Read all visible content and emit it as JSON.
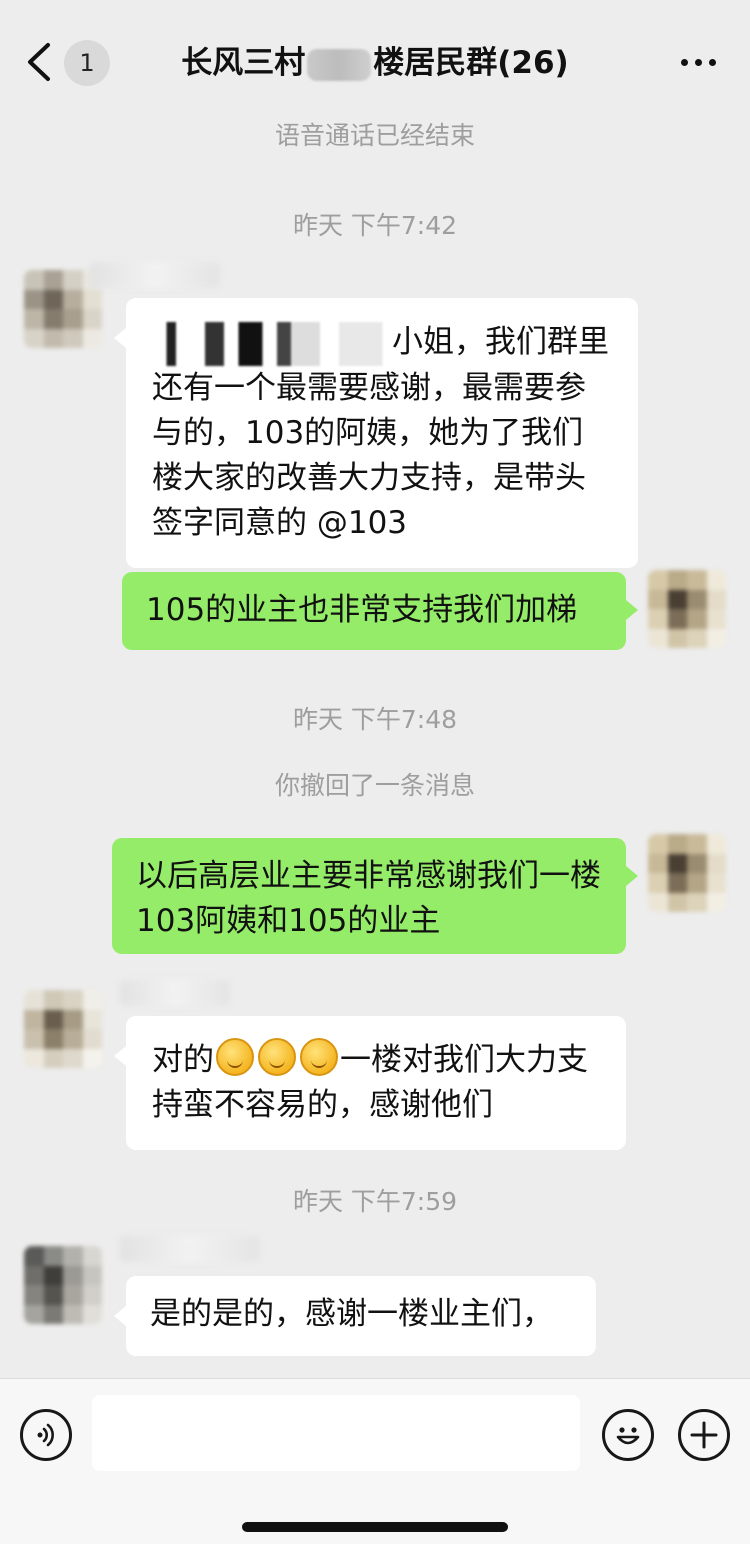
{
  "header": {
    "unread_count": "1",
    "title_prefix": "长风三村",
    "title_suffix": "楼居民群(26)"
  },
  "messages": {
    "sys_call_ended": "语音通话已经结束",
    "time_1": "昨天 下午7:42",
    "msg_1_text": "小姐，我们群里还有一个最需要感谢，最需要参与的，103的阿姨，她为了我们楼大家的改善大力支持，是带头签字同意的 @103",
    "msg_2_text": "105的业主也非常支持我们加梯",
    "time_2": "昨天 下午7:48",
    "sys_recalled": "你撤回了一条消息",
    "msg_3_text": "以后高层业主要非常感谢我们一楼103阿姨和105的业主",
    "msg_4_prefix": "对的",
    "msg_4_suffix": "一楼对我们大力支持蛮不容易的，感谢他们",
    "time_3": "昨天 下午7:59",
    "msg_5_text": "是的是的，感谢一楼业主们，"
  },
  "input_bar": {
    "voice_icon": "voice-icon",
    "emoji_icon": "emoji-icon",
    "plus_icon": "plus-icon"
  },
  "colors": {
    "background": "#ededed",
    "bubble_self": "#95ec69",
    "bubble_other": "#ffffff",
    "system_text": "#9e9e9e"
  }
}
